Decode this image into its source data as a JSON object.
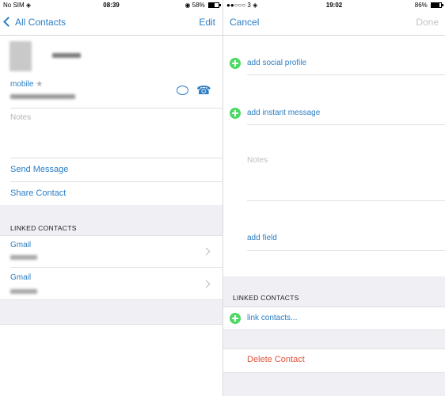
{
  "left": {
    "status": {
      "carrier": "No SIM",
      "time": "08:39",
      "battery": "58%",
      "battery_level": 0.58
    },
    "nav": {
      "back_label": "All Contacts",
      "edit_label": "Edit"
    },
    "phone_label": "mobile",
    "notes_label": "Notes",
    "actions": {
      "send_message": "Send Message",
      "share_contact": "Share Contact"
    },
    "linked_header": "LINKED CONTACTS",
    "linked": [
      {
        "source": "Gmail"
      },
      {
        "source": "Gmail"
      }
    ]
  },
  "right": {
    "status": {
      "carrier": "3",
      "time": "19:02",
      "battery": "86%",
      "battery_level": 0.86
    },
    "nav": {
      "cancel_label": "Cancel",
      "done_label": "Done"
    },
    "add_social_profile": "add social profile",
    "add_instant_message": "add instant message",
    "notes_placeholder": "Notes",
    "add_field": "add field",
    "linked_header": "LINKED CONTACTS",
    "link_contacts": "link contacts...",
    "delete_contact": "Delete Contact"
  },
  "colors": {
    "accent": "#2a7ec4",
    "green": "#4cd964",
    "destructive": "#e0533a",
    "group_bg": "#efeff4"
  }
}
